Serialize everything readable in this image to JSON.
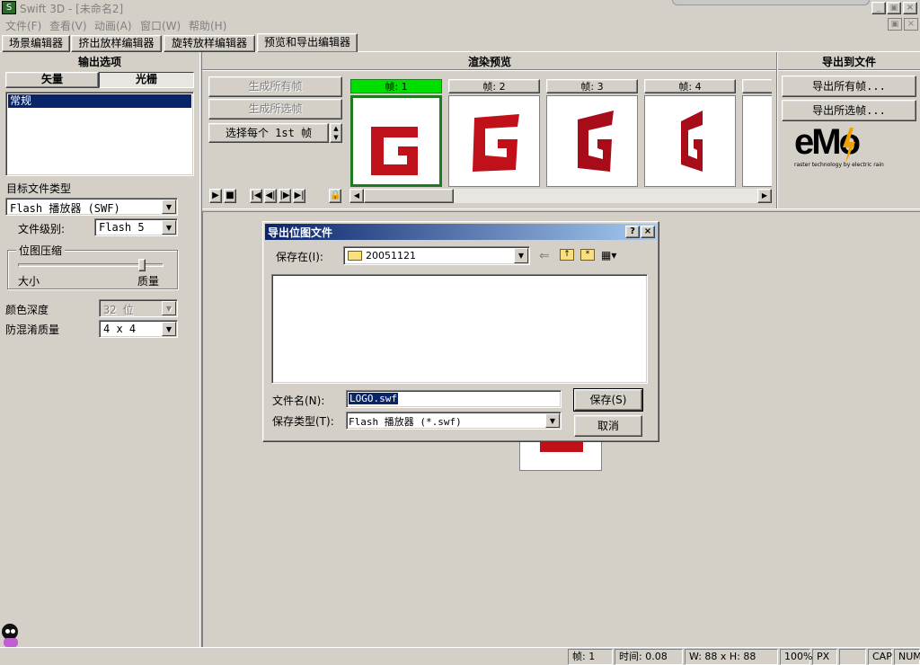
{
  "window": {
    "title": "Swift 3D - [未命名2]",
    "app_icon": "swift3d-icon"
  },
  "menu": [
    "文件(F)",
    "查看(V)",
    "动画(A)",
    "窗口(W)",
    "帮助(H)"
  ],
  "tabs": [
    "场景编辑器",
    "挤出放样编辑器",
    "旋转放样编辑器",
    "预览和导出编辑器"
  ],
  "output_panel": {
    "header": "输出选项",
    "tabs": [
      "矢量",
      "光栅"
    ],
    "list_items": [
      "常规"
    ],
    "target_type_label": "目标文件类型",
    "target_type_value": "Flash 播放器 (SWF)",
    "file_level_label": "文件级别:",
    "file_level_value": "Flash 5",
    "compression_group": "位图压缩",
    "slider_left": "大小",
    "slider_right": "质量",
    "slider_level": 0.85,
    "color_depth_label": "颜色深度",
    "color_depth_value": "32 位",
    "aa_label": "防混淆质量",
    "aa_value": "4 x 4"
  },
  "render_panel": {
    "header": "渲染预览",
    "gen_all": "生成所有帧",
    "gen_selected": "生成所选帧",
    "select_each": "选择每个 1st 帧",
    "frames": [
      "帧: 1",
      "帧: 2",
      "帧: 3",
      "帧: 4"
    ]
  },
  "export_panel": {
    "header": "导出到文件",
    "export_all": "导出所有帧...",
    "export_selected": "导出所选帧...",
    "logo_text": "eMo",
    "logo_sub": "raster technology by electric rain"
  },
  "dialog": {
    "title": "导出位图文件",
    "save_in_label": "保存在(I):",
    "save_in_value": "20051121",
    "filename_label": "文件名(N):",
    "filename_value": "LOGO.swf",
    "filetype_label": "保存类型(T):",
    "filetype_value": "Flash 播放器 (*.swf)",
    "save_button": "保存(S)",
    "cancel_button": "取消"
  },
  "status": {
    "frame": "帧: 1",
    "time": "时间: 0.08",
    "size": "W: 88 x H: 88",
    "zoom": "100%",
    "unit": "PX",
    "cap": "CAP",
    "num": "NUM"
  },
  "colors": {
    "accent_red": "#c0101a",
    "selected_green": "#00e000",
    "title_blue": "#0a246a"
  }
}
